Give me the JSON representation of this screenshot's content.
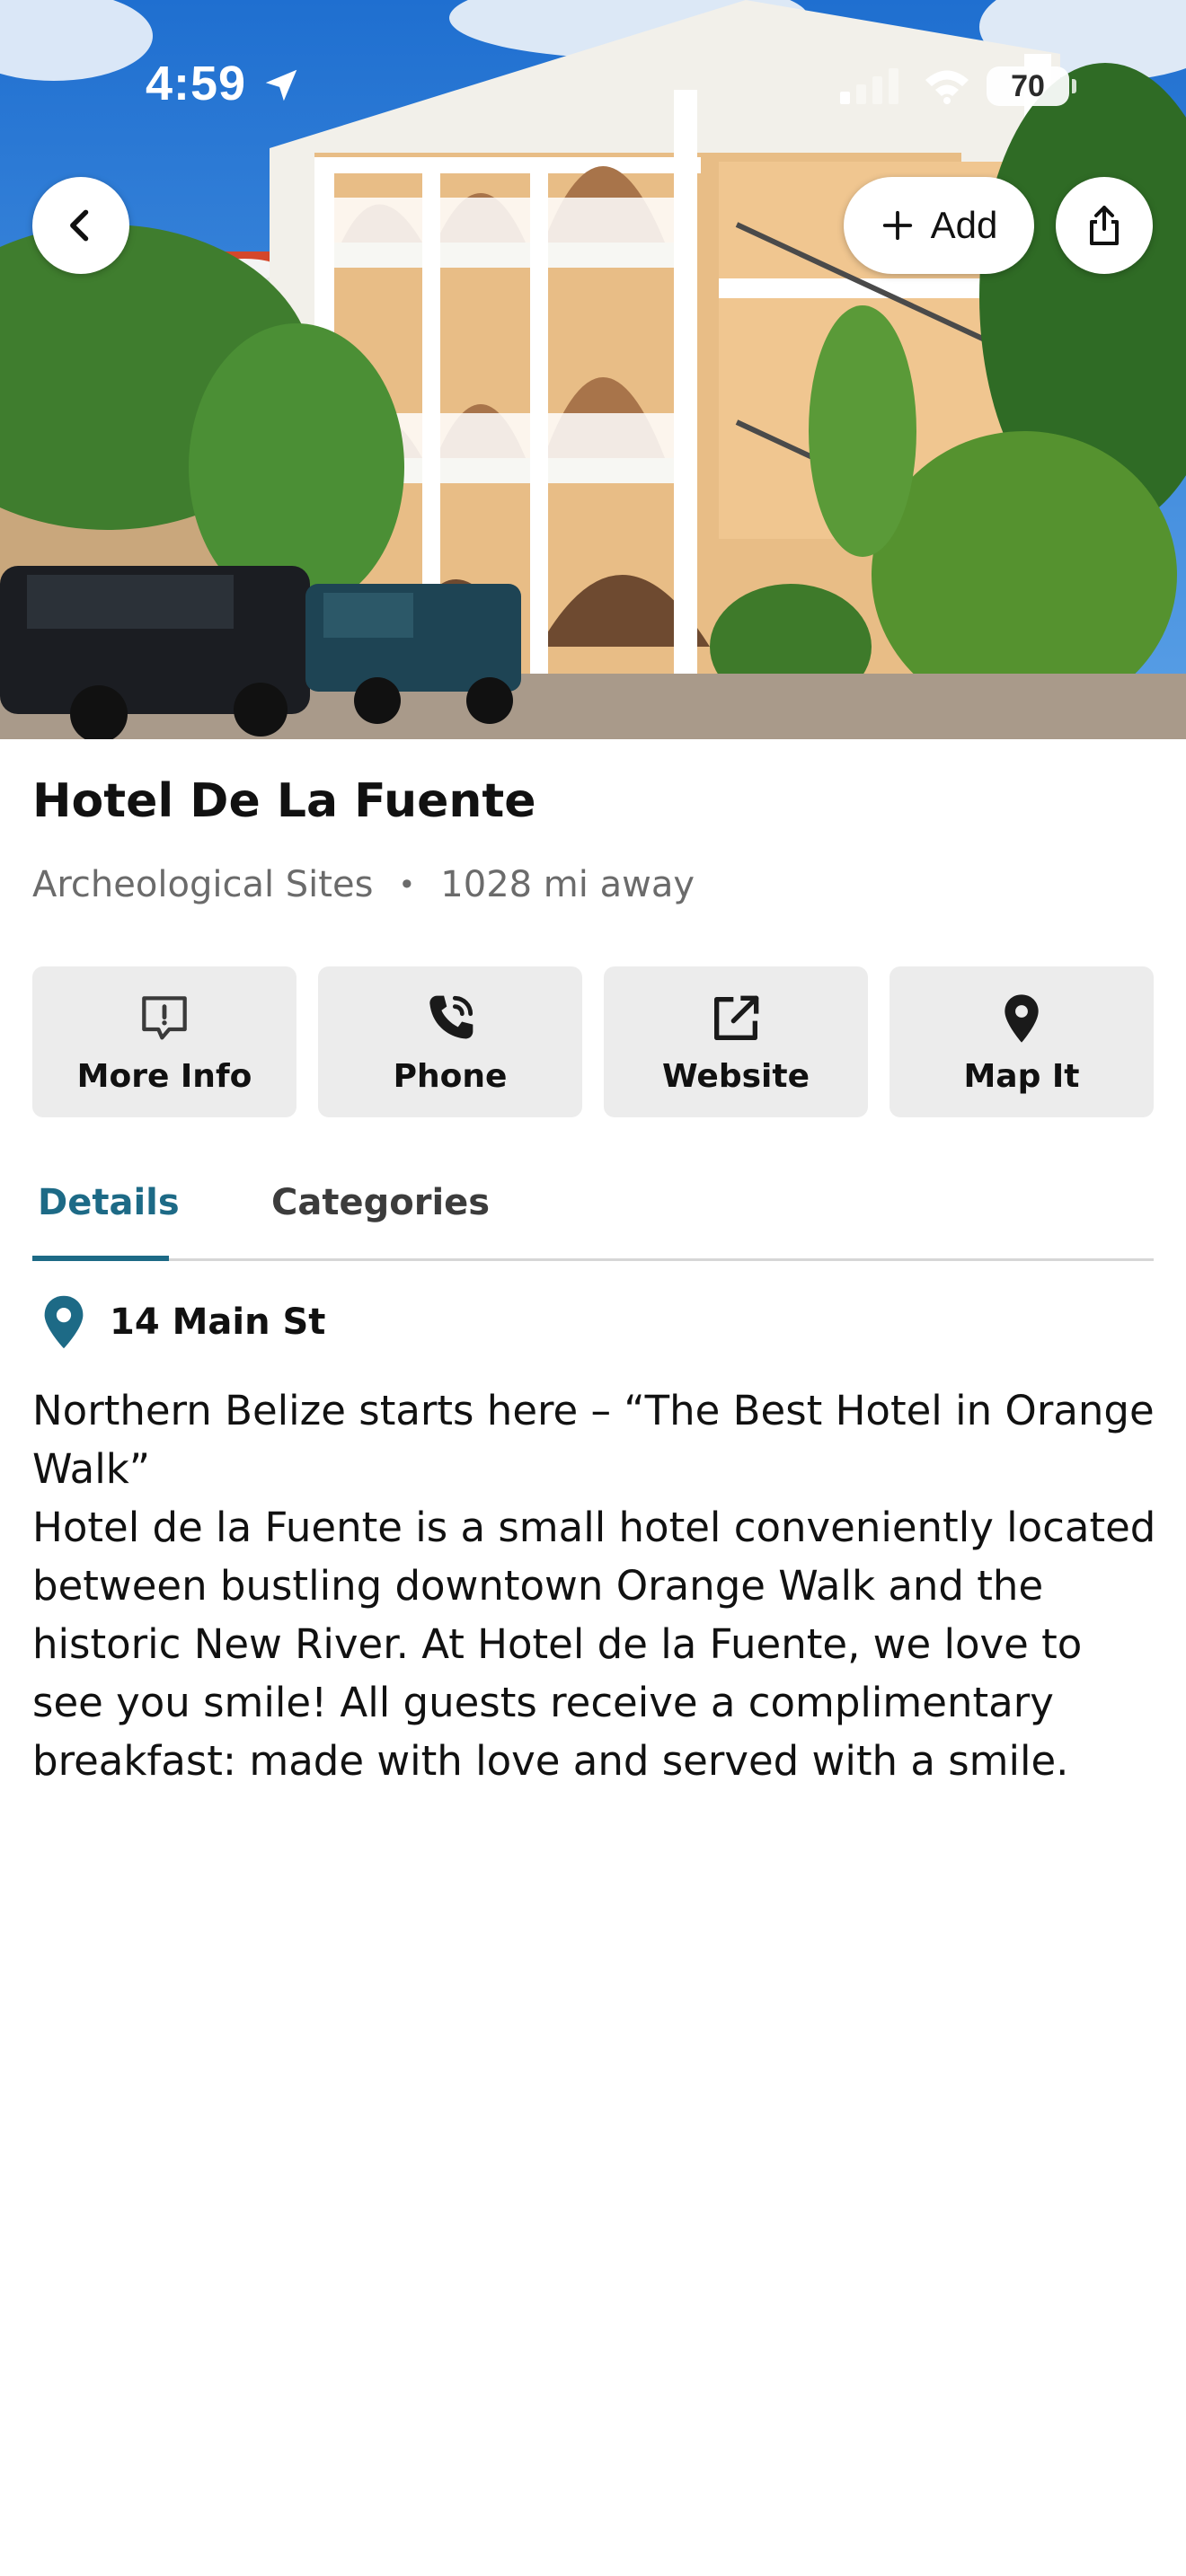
{
  "status_bar": {
    "time": "4:59",
    "battery": "70",
    "icons": [
      "location-arrow-icon",
      "cellular-signal-icon",
      "wifi-icon",
      "battery-icon"
    ]
  },
  "hero": {
    "image": "hotel-photo",
    "back_icon": "chevron-left-icon",
    "add_label": "Add",
    "add_icon": "plus-icon",
    "share_icon": "share-icon"
  },
  "place": {
    "name": "Hotel De La Fuente",
    "category": "Archeological Sites",
    "separator": "•",
    "distance": "1028 mi away"
  },
  "actions": [
    {
      "label": "More Info",
      "icon": "info-message-icon"
    },
    {
      "label": "Phone",
      "icon": "phone-icon"
    },
    {
      "label": "Website",
      "icon": "external-link-icon"
    },
    {
      "label": "Map It",
      "icon": "map-pin-icon"
    }
  ],
  "tabs": [
    {
      "label": "Details",
      "active": true
    },
    {
      "label": "Categories",
      "active": false
    }
  ],
  "details": {
    "address": "14 Main St",
    "address_icon": "map-pin-icon",
    "tagline": "Northern Belize starts here – “The Best Hotel in Orange Walk”",
    "body": "Hotel de la Fuente is a small hotel conveniently located between bustling downtown Orange Walk and the historic New River. At Hotel de la Fuente, we love to see you smile! All guests receive a complimentary breakfast: made with love and served with a smile."
  },
  "colors": {
    "accent": "#1d6a86",
    "button_bg": "#ececec",
    "muted_text": "#6b6b6b"
  }
}
